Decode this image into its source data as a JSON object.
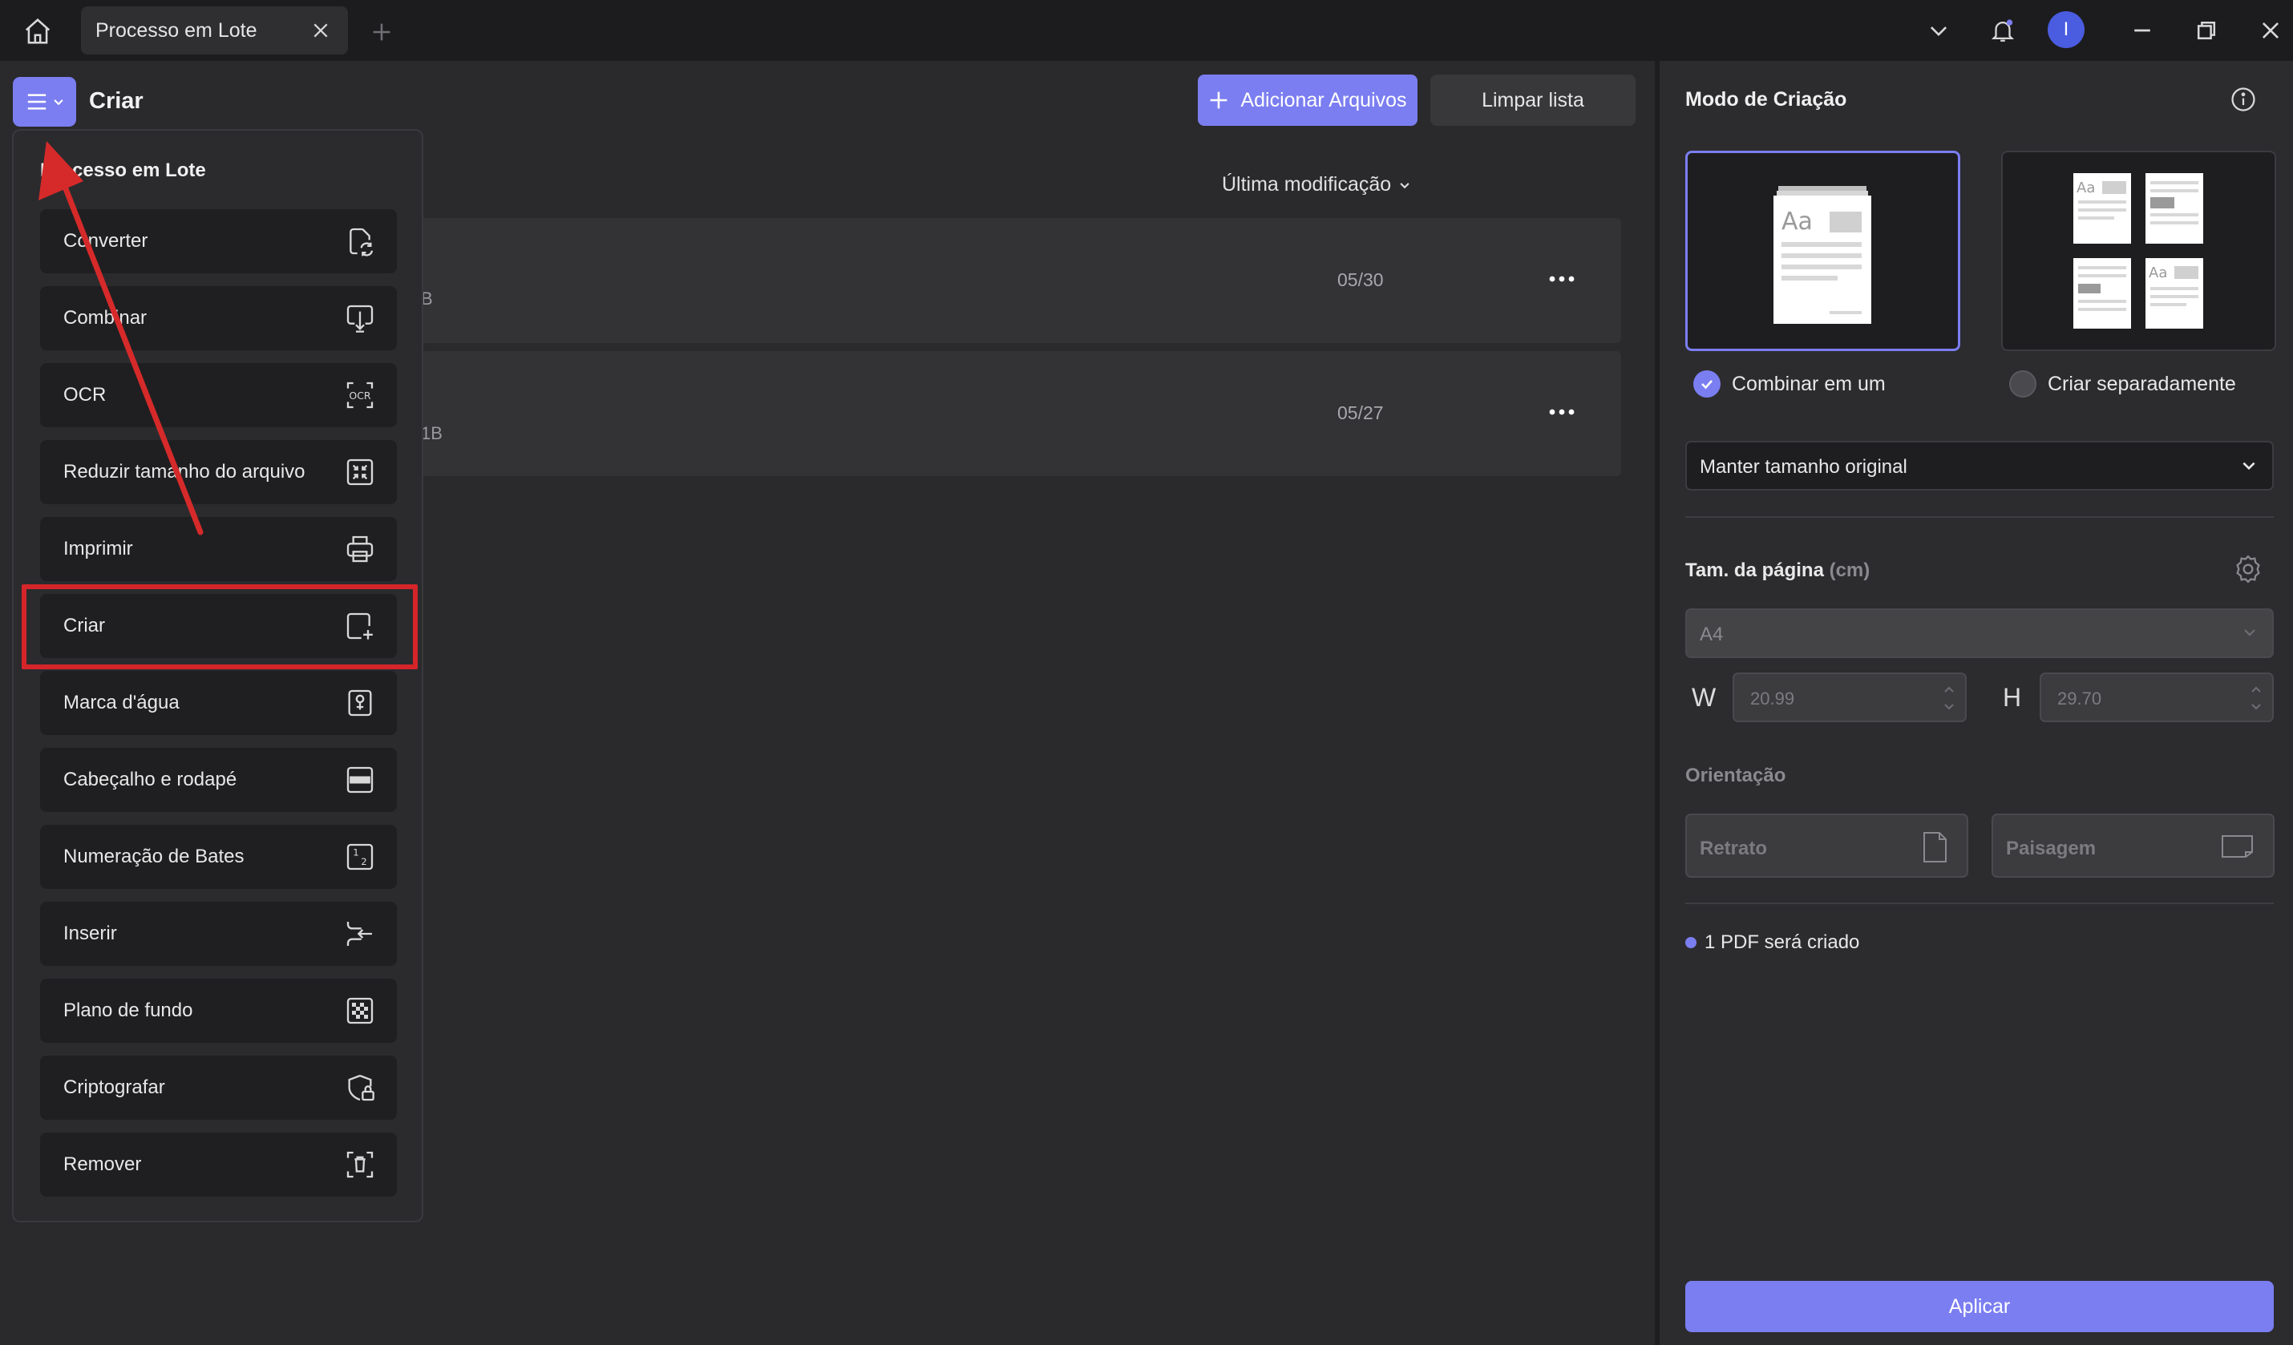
{
  "titlebar": {
    "tab_title": "Processo em Lote",
    "avatar_initial": "I"
  },
  "header": {
    "title": "Criar",
    "add_files": "Adicionar Arquivos",
    "clear_list": "Limpar lista"
  },
  "file_list": {
    "sort_label": "Última modificação",
    "rows": [
      {
        "size_partial": "B",
        "date": "05/30"
      },
      {
        "size_partial": "1B",
        "date": "05/27"
      }
    ]
  },
  "menu": {
    "title": "Processo em Lote",
    "items": [
      {
        "label": "Converter",
        "icon": "convert-icon"
      },
      {
        "label": "Combinar",
        "icon": "combine-icon"
      },
      {
        "label": "OCR",
        "icon": "ocr-icon"
      },
      {
        "label": "Reduzir tamanho do arquivo",
        "icon": "compress-icon"
      },
      {
        "label": "Imprimir",
        "icon": "printer-icon"
      },
      {
        "label": "Criar",
        "icon": "create-icon"
      },
      {
        "label": "Marca d'água",
        "icon": "watermark-icon"
      },
      {
        "label": "Cabeçalho e rodapé",
        "icon": "header-footer-icon"
      },
      {
        "label": "Numeração de Bates",
        "icon": "bates-numbering-icon"
      },
      {
        "label": "Inserir",
        "icon": "insert-icon"
      },
      {
        "label": "Plano de fundo",
        "icon": "background-icon"
      },
      {
        "label": "Criptografar",
        "icon": "encrypt-icon"
      },
      {
        "label": "Remover",
        "icon": "remove-icon"
      }
    ],
    "selected": "Criar"
  },
  "panel": {
    "title": "Modo de Criação",
    "mode_combine": "Combinar em um",
    "mode_separate": "Criar separadamente",
    "selected_mode": "Combinar em um",
    "size_option": "Manter tamanho original",
    "page_size_label": "Tam. da página",
    "page_size_unit": "(cm)",
    "paper": "A4",
    "w_label": "W",
    "h_label": "H",
    "width": "20.99",
    "height": "29.70",
    "orientation_label": "Orientação",
    "portrait": "Retrato",
    "landscape": "Paisagem",
    "status": "1 PDF será criado",
    "apply": "Aplicar"
  },
  "colors": {
    "accent": "#7b7ef0",
    "highlight_box": "#d6252a",
    "annotation_arrow": "#d62a2a",
    "background": "#2a2a2d"
  }
}
